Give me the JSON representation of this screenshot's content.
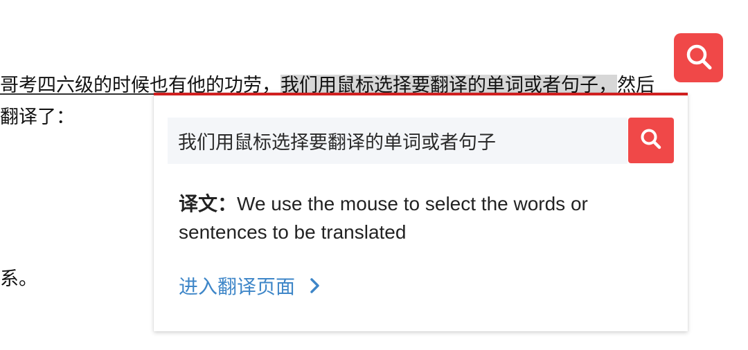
{
  "article": {
    "line1_before": "哥考四六级的时候也有他的功劳，",
    "line1_selected": "我们用鼠标选择要翻译的单词或者句子，",
    "line1_after": "然后",
    "line2": "翻译了：",
    "line3": "系。"
  },
  "popup": {
    "search_value": "我们用鼠标选择要翻译的单词或者句子",
    "translation_label": "译文：",
    "translation_text": "We use the mouse to select the words or sentences to be translated",
    "goto_link": "进入翻译页面"
  },
  "icons": {
    "float_button": "search-icon",
    "search_button": "search-icon",
    "link_chevron": "chevron-right-icon"
  },
  "colors": {
    "accent_red": "#f04848",
    "popup_border": "#d01f1f",
    "link_blue": "#3e86c8",
    "selection_bg": "#d7d7d7"
  }
}
